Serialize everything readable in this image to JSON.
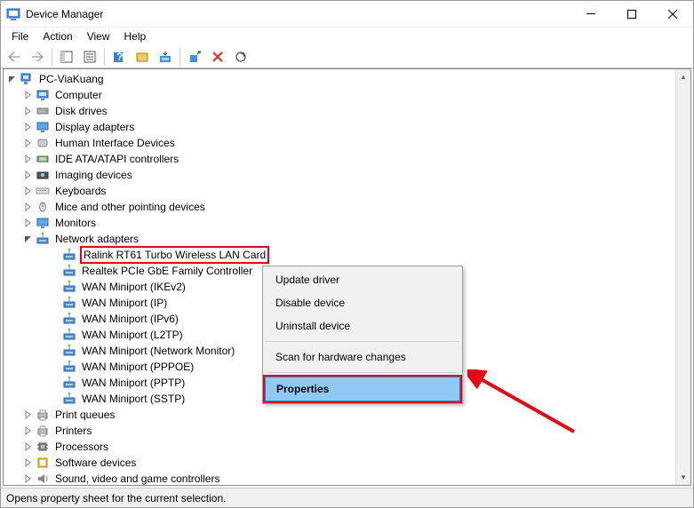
{
  "window": {
    "title": "Device Manager"
  },
  "menu": {
    "file": "File",
    "action": "Action",
    "view": "View",
    "help": "Help"
  },
  "tree": {
    "root": "PC-ViaKuang",
    "categories": [
      {
        "label": "Computer",
        "icon": "computer"
      },
      {
        "label": "Disk drives",
        "icon": "disk"
      },
      {
        "label": "Display adapters",
        "icon": "display"
      },
      {
        "label": "Human Interface Devices",
        "icon": "hid"
      },
      {
        "label": "IDE ATA/ATAPI controllers",
        "icon": "ide"
      },
      {
        "label": "Imaging devices",
        "icon": "imaging"
      },
      {
        "label": "Keyboards",
        "icon": "keyboard"
      },
      {
        "label": "Mice and other pointing devices",
        "icon": "mouse"
      },
      {
        "label": "Monitors",
        "icon": "monitor"
      }
    ],
    "networkCategory": "Network adapters",
    "networkAdapters": [
      "Ralink RT61 Turbo Wireless LAN Card",
      "Realtek PCIe GbE Family Controller",
      "WAN Miniport (IKEv2)",
      "WAN Miniport (IP)",
      "WAN Miniport (IPv6)",
      "WAN Miniport (L2TP)",
      "WAN Miniport (Network Monitor)",
      "WAN Miniport (PPPOE)",
      "WAN Miniport (PPTP)",
      "WAN Miniport (SSTP)"
    ],
    "moreCategories": [
      {
        "label": "Print queues",
        "icon": "printer"
      },
      {
        "label": "Printers",
        "icon": "printer"
      },
      {
        "label": "Processors",
        "icon": "cpu"
      },
      {
        "label": "Software devices",
        "icon": "software"
      },
      {
        "label": "Sound, video and game controllers",
        "icon": "sound"
      }
    ]
  },
  "contextMenu": {
    "updateDriver": "Update driver",
    "disableDevice": "Disable device",
    "uninstallDevice": "Uninstall device",
    "scanHardware": "Scan for hardware changes",
    "properties": "Properties"
  },
  "statusbar": "Opens property sheet for the current selection.",
  "colors": {
    "highlightRed": "#e30613",
    "selectBlue": "#90c8f6"
  }
}
